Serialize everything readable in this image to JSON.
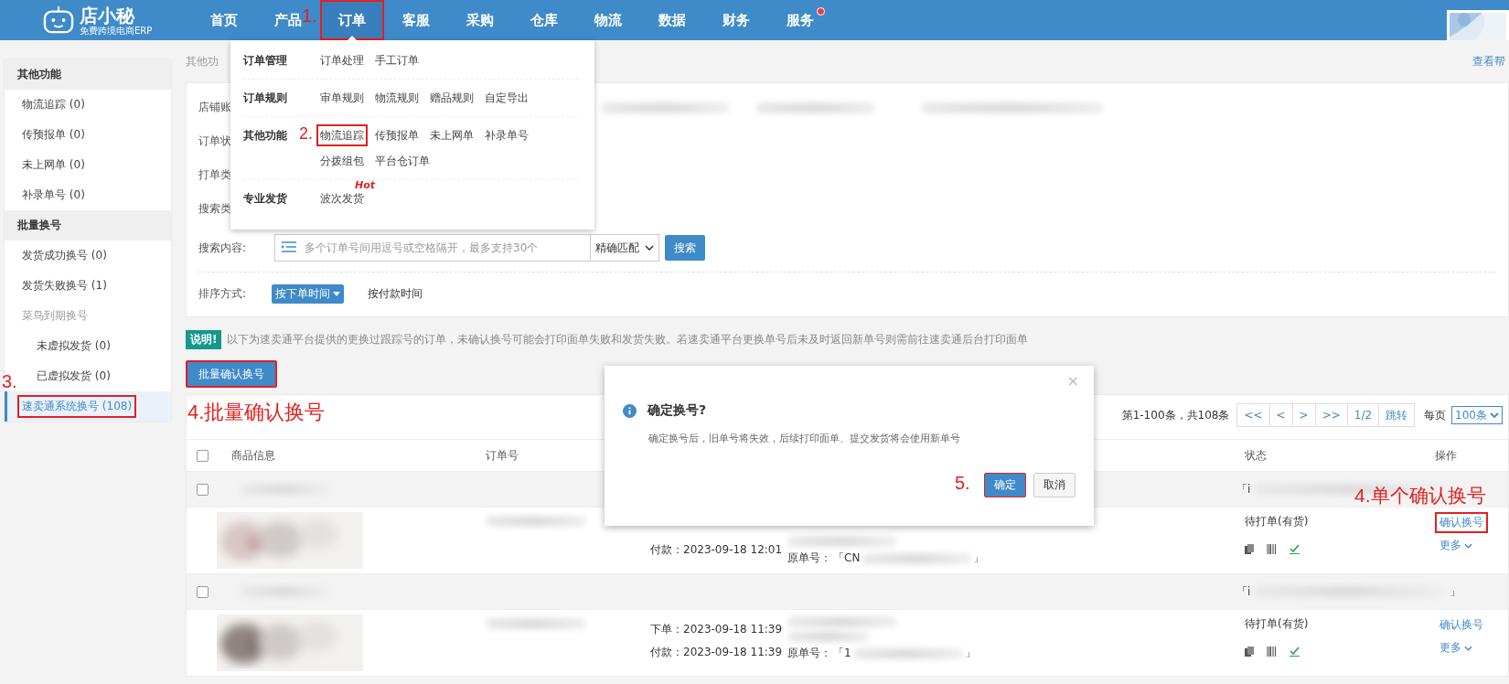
{
  "top_nav": {
    "logo": {
      "name": "店小秘",
      "tagline": "免费跨境电商ERP"
    },
    "items": [
      {
        "label": "首页",
        "selected": false,
        "marked": false,
        "dot": false
      },
      {
        "label": "产品",
        "selected": false,
        "marked": false,
        "dot": false
      },
      {
        "label": "订单",
        "selected": true,
        "marked": true,
        "dot": false,
        "note": "1."
      },
      {
        "label": "客服",
        "selected": false,
        "marked": false,
        "dot": false
      },
      {
        "label": "采购",
        "selected": false,
        "marked": false,
        "dot": false
      },
      {
        "label": "仓库",
        "selected": false,
        "marked": false,
        "dot": false
      },
      {
        "label": "物流",
        "selected": false,
        "marked": false,
        "dot": false
      },
      {
        "label": "数据",
        "selected": false,
        "marked": false,
        "dot": false
      },
      {
        "label": "财务",
        "selected": false,
        "marked": false,
        "dot": false
      },
      {
        "label": "服务",
        "selected": false,
        "marked": false,
        "dot": true
      }
    ]
  },
  "nav_dropdown": {
    "groups": [
      {
        "title": "订单管理",
        "links": [
          {
            "label": "订单处理",
            "marked": false
          },
          {
            "label": "手工订单",
            "marked": false
          }
        ]
      },
      {
        "title": "订单规则",
        "links": [
          {
            "label": "审单规则",
            "marked": false
          },
          {
            "label": "物流规则",
            "marked": false
          },
          {
            "label": "赠品规则",
            "marked": false
          },
          {
            "label": "自定导出",
            "marked": false
          }
        ]
      },
      {
        "title": "其他功能",
        "links": [
          {
            "label": "物流追踪",
            "marked": true,
            "note": "2."
          },
          {
            "label": "传预报单",
            "marked": false
          },
          {
            "label": "未上网单",
            "marked": false
          },
          {
            "label": "补录单号",
            "marked": false
          },
          {
            "label": "分拨组包",
            "marked": false
          },
          {
            "label": "平台仓订单",
            "marked": false
          }
        ]
      },
      {
        "title": "专业发货",
        "links": [
          {
            "label": "波次发货",
            "marked": false,
            "tag": "Hot"
          }
        ]
      }
    ]
  },
  "sidebar": {
    "sections": [
      {
        "title": "其他功能",
        "items": [
          {
            "label": "物流追踪 (0)",
            "selected": false,
            "marked": false,
            "disabled": false
          },
          {
            "label": "传预报单 (0)",
            "selected": false,
            "marked": false,
            "disabled": false
          },
          {
            "label": "未上网单 (0)",
            "selected": false,
            "marked": false,
            "disabled": false
          },
          {
            "label": "补录单号 (0)",
            "selected": false,
            "marked": false,
            "disabled": false
          }
        ]
      },
      {
        "title": "批量换号",
        "items": [
          {
            "label": "发货成功换号 (0)",
            "selected": false,
            "marked": false,
            "disabled": false
          },
          {
            "label": "发货失败换号 (1)",
            "selected": false,
            "marked": false,
            "disabled": false
          },
          {
            "label": "菜鸟到期换号",
            "selected": false,
            "marked": false,
            "disabled": true,
            "children": [
              {
                "label": "未虚拟发货 (0)",
                "selected": false,
                "marked": false,
                "disabled": false
              },
              {
                "label": "已虚拟发货 (0)",
                "selected": false,
                "marked": false,
                "disabled": false
              }
            ]
          },
          {
            "label": "速卖通系统换号 (108)",
            "selected": true,
            "marked": true,
            "disabled": false,
            "note": "3."
          }
        ]
      }
    ]
  },
  "breadcrumb": "其他功",
  "help_link": "查看帮",
  "filters": {
    "cut_labels": [
      "店铺账",
      "订单状",
      "打单类",
      "搜索类"
    ],
    "search": {
      "label": "搜索内容:",
      "placeholder": "多个订单号间用逗号或空格隔开，最多支持30个",
      "match": "精确匹配",
      "button": "搜索"
    },
    "sort": {
      "label": "排序方式:",
      "options": [
        {
          "label": "按下单时间",
          "selected": true
        },
        {
          "label": "按付款时间",
          "selected": false
        }
      ]
    }
  },
  "notice": {
    "tag": "说明!",
    "text": "以下为速卖通平台提供的更换过跟踪号的订单，未确认换号可能会打印面单失败和发货失败。若速卖通平台更换单号后未及时返回新单号则需前往速卖通后台打印面单"
  },
  "bulk_button": {
    "label": "批量确认换号",
    "marked": true,
    "note": "4.批量确认换号"
  },
  "pagination": {
    "summary": "第1-100条，共108条",
    "buttons": [
      "<<",
      "<",
      ">",
      ">>",
      "1/2",
      "跳转"
    ],
    "per_page_label": "每页",
    "per_page": "100条"
  },
  "table": {
    "columns": [
      "商品信息",
      "订单号",
      "状态",
      "操作"
    ],
    "header_checked": false,
    "groups": [
      {
        "checked": false,
        "tail_prefix": "「i",
        "times": [
          "付款：2023-09-18 12:01"
        ],
        "original": {
          "label": "原单号：",
          "head": "「CN",
          "tail": "」"
        },
        "status": "待打单(有货)",
        "actions": [
          {
            "label": "确认换号",
            "kind": "link",
            "marked": true,
            "note": "4.单个确认换号"
          },
          {
            "label": "更多",
            "kind": "menu",
            "marked": false
          }
        ]
      },
      {
        "checked": false,
        "tail_prefix": "「i",
        "tail_suffix": "」",
        "times": [
          "下单：2023-09-18 11:39",
          "付款：2023-09-18 11:39"
        ],
        "original": {
          "label": "原单号：",
          "head": "「1",
          "tail": "」"
        },
        "status": "待打单(有货)",
        "actions": [
          {
            "label": "确认换号",
            "kind": "link",
            "marked": false
          },
          {
            "label": "更多",
            "kind": "menu",
            "marked": false
          }
        ]
      }
    ]
  },
  "modal": {
    "title": "确定换号?",
    "message": "确定换号后，旧单号将失效，后续打印面单、提交发货将会使用新单号",
    "close": "×",
    "buttons": [
      {
        "label": "确定",
        "kind": "primary",
        "marked": true,
        "note": "5."
      },
      {
        "label": "取消",
        "kind": "default",
        "marked": false
      }
    ]
  }
}
